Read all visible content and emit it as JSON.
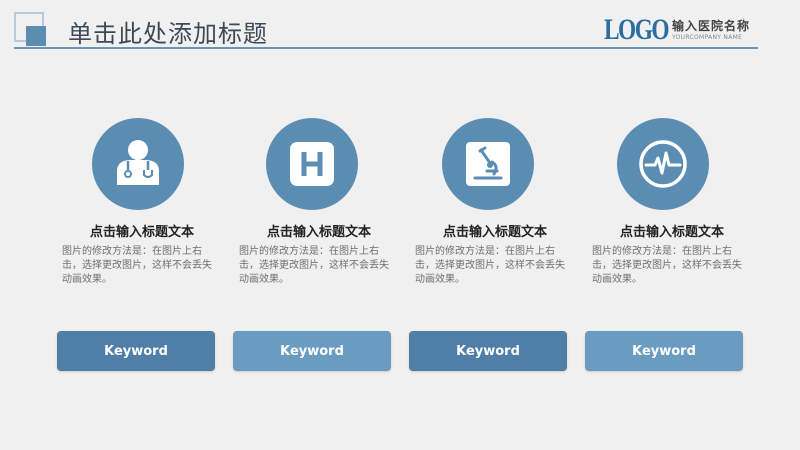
{
  "header": {
    "title": "单击此处添加标题",
    "logo_text": "LOGO",
    "org_name": "输入医院名称",
    "org_sub": "YOURCOMPANY NAME"
  },
  "colors": {
    "accent": "#5b8db3",
    "button_dark": "#4f7fa6",
    "button_light": "#6a9bc0",
    "background": "#f0f0f0"
  },
  "items": [
    {
      "icon": "doctor-stethoscope-icon",
      "title": "点击输入标题文本",
      "text": "图片的修改方法是：在图片上右击，选择更改图片，这样不会丢失动画效果。",
      "keyword": "Keyword"
    },
    {
      "icon": "hospital-h-icon",
      "title": "点击输入标题文本",
      "text": "图片的修改方法是：在图片上右击，选择更改图片，这样不会丢失动画效果。",
      "keyword": "Keyword"
    },
    {
      "icon": "microscope-icon",
      "title": "点击输入标题文本",
      "text": "图片的修改方法是：在图片上右击，选择更改图片，这样不会丢失动画效果。",
      "keyword": "Keyword"
    },
    {
      "icon": "heartbeat-icon",
      "title": "点击输入标题文本",
      "text": "图片的修改方法是：在图片上右击，选择更改图片，这样不会丢失动画效果。",
      "keyword": "Keyword"
    }
  ]
}
